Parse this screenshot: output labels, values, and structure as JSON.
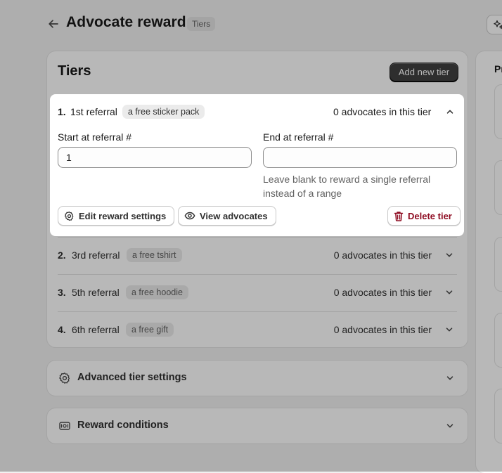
{
  "header": {
    "title": "Advocate reward",
    "badge": "Tiers"
  },
  "tiers_card": {
    "title": "Tiers",
    "add_button": "Add new tier",
    "tiers": [
      {
        "number": "1.",
        "name": "1st referral",
        "reward": "a free sticker pack",
        "count": "0 advocates in this tier",
        "expanded": true
      },
      {
        "number": "2.",
        "name": "3rd referral",
        "reward": "a free tshirt",
        "count": "0 advocates in this tier"
      },
      {
        "number": "3.",
        "name": "5th referral",
        "reward": "a free hoodie",
        "count": "0 advocates in this tier"
      },
      {
        "number": "4.",
        "name": "6th referral",
        "reward": "a free gift",
        "count": "0 advocates in this tier"
      }
    ]
  },
  "expanded_tier": {
    "start_label": "Start at referral #",
    "start_value": "1",
    "end_label": "End at referral #",
    "end_value": "",
    "end_help": "Leave blank to reward a single referral instead of a range",
    "edit_button": "Edit reward settings",
    "view_button": "View advocates",
    "delete_button": "Delete tier"
  },
  "sections": {
    "advanced": "Advanced tier settings",
    "conditions": "Reward conditions"
  },
  "right_panel": {
    "title": "Pr"
  },
  "colors": {
    "primary_button": "#404040",
    "danger": "#8e0b21",
    "overlay": "rgba(0,0,0,0.28)"
  }
}
